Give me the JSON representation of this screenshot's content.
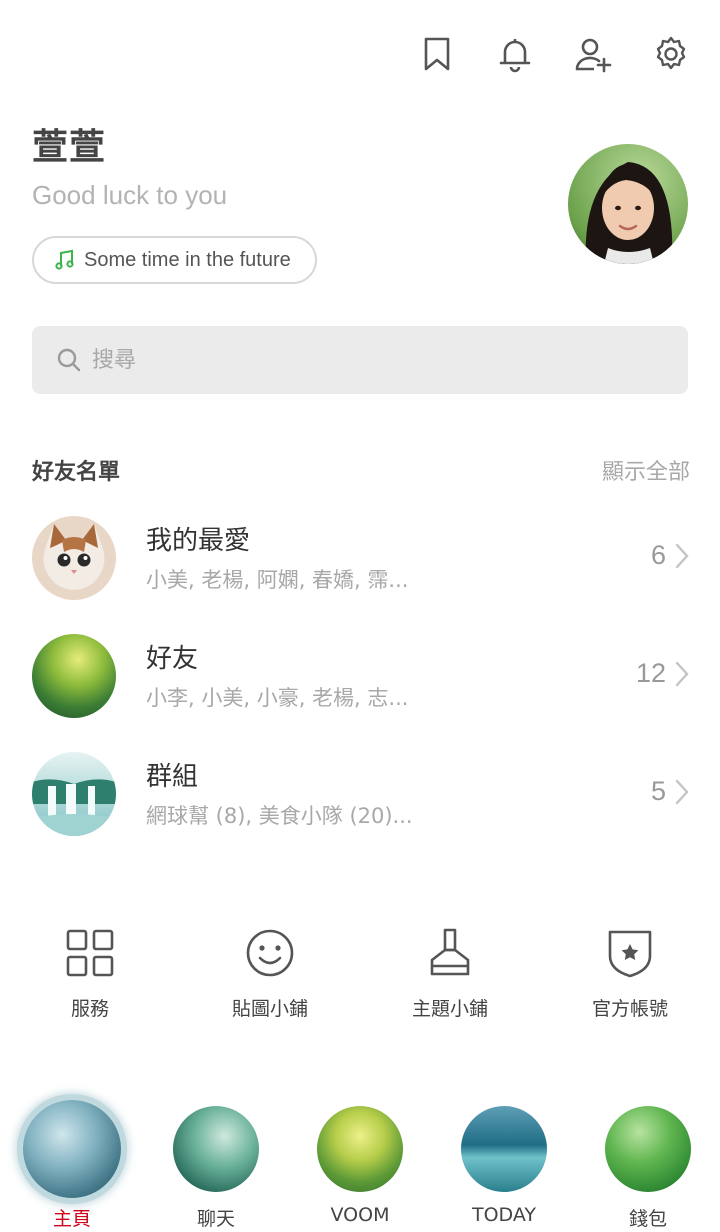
{
  "profile": {
    "name": "萱萱",
    "status_message": "Good luck to you",
    "music": "Some time in the future"
  },
  "search": {
    "placeholder": "搜尋"
  },
  "friends_section": {
    "title": "好友名單",
    "show_all": "顯示全部",
    "rows": [
      {
        "title": "我的最愛",
        "subtitle": "小美, 老楊, 阿嫻, 春嬌, 霈...",
        "count": "6"
      },
      {
        "title": "好友",
        "subtitle": "小李, 小美, 小豪, 老楊, 志...",
        "count": "12"
      },
      {
        "title": "群組",
        "subtitle": "網球幫 (8), 美食小隊 (20)...",
        "count": "5"
      }
    ]
  },
  "services": [
    {
      "label": "服務",
      "icon": "grid-icon"
    },
    {
      "label": "貼圖小鋪",
      "icon": "smiley-icon"
    },
    {
      "label": "主題小鋪",
      "icon": "brush-icon"
    },
    {
      "label": "官方帳號",
      "icon": "shield-star-icon"
    }
  ],
  "bottom_nav": [
    {
      "label": "主頁",
      "active": true
    },
    {
      "label": "聊天",
      "active": false
    },
    {
      "label": "VOOM",
      "active": false
    },
    {
      "label": "TODAY",
      "active": false
    },
    {
      "label": "錢包",
      "active": false
    }
  ],
  "top_icons": [
    "bookmark-icon",
    "bell-icon",
    "add-friend-icon",
    "gear-icon"
  ],
  "colors": {
    "active_nav": "#d0021b",
    "music_note": "#3bb54a",
    "muted_text": "#a8a8a8"
  }
}
